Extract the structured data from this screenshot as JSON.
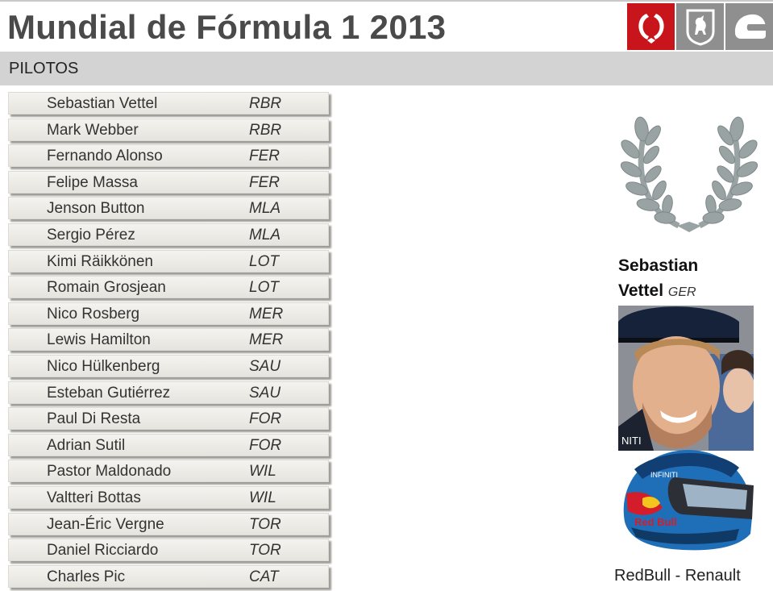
{
  "header": {
    "title": "Mundial de Fórmula 1 2013",
    "icons": [
      "laurel-icon",
      "ferrari-horse-icon",
      "helmet-icon"
    ]
  },
  "section": {
    "label": "PILOTOS"
  },
  "drivers": [
    {
      "name": "Sebastian Vettel",
      "team": "RBR"
    },
    {
      "name": "Mark Webber",
      "team": "RBR"
    },
    {
      "name": "Fernando Alonso",
      "team": "FER"
    },
    {
      "name": "Felipe Massa",
      "team": "FER"
    },
    {
      "name": "Jenson Button",
      "team": "MLA"
    },
    {
      "name": "Sergio Pérez",
      "team": "MLA"
    },
    {
      "name": "Kimi Räikkönen",
      "team": "LOT"
    },
    {
      "name": "Romain Grosjean",
      "team": "LOT"
    },
    {
      "name": "Nico Rosberg",
      "team": "MER"
    },
    {
      "name": "Lewis Hamilton",
      "team": "MER"
    },
    {
      "name": "Nico Hülkenberg",
      "team": "SAU"
    },
    {
      "name": "Esteban Gutiérrez",
      "team": "SAU"
    },
    {
      "name": "Paul Di Resta",
      "team": "FOR"
    },
    {
      "name": "Adrian Sutil",
      "team": "FOR"
    },
    {
      "name": "Pastor Maldonado",
      "team": "WIL"
    },
    {
      "name": "Valtteri Bottas",
      "team": "WIL"
    },
    {
      "name": "Jean-Éric Vergne",
      "team": "TOR"
    },
    {
      "name": "Daniel Ricciardo",
      "team": "TOR"
    },
    {
      "name": "Charles Pic",
      "team": "CAT"
    }
  ],
  "selected": {
    "first_name": "Sebastian",
    "last_name": "Vettel",
    "nationality": "GER",
    "team": "RedBull - Renault"
  },
  "colors": {
    "accent": "#c8151b",
    "icon_grey": "#8f8f8f",
    "subheader_bg": "#d3d3d3",
    "laurel": "#9aa3a3"
  }
}
